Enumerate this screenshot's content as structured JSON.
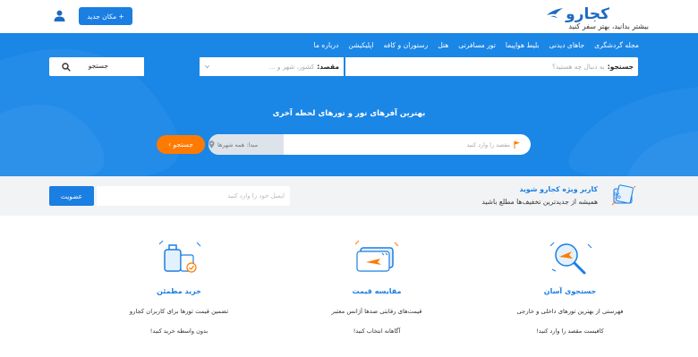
{
  "header": {
    "logo_name": "کجارو",
    "logo_tagline": "بیشتر بدانید، بهتر سفر کنید",
    "add_place_label": "+ مکان جدید",
    "brand_color": "#1d6bc2",
    "icons": {
      "logo": "bird-logo-icon",
      "user": "user-icon"
    }
  },
  "nav": {
    "items": [
      "مجله گردشگری",
      "جاهای دیدنی",
      "بلیط هواپیما",
      "تور مسافرتی",
      "هتل",
      "رستوران و کافه",
      "اپلیکیشن",
      "درباره ما"
    ]
  },
  "search": {
    "what_label": "جستجو:",
    "what_placeholder": "به دنبال چه هستید؟",
    "dest_label": "مقصد:",
    "dest_placeholder": "کشور، شهر و ...",
    "button_label": "جستجو"
  },
  "hero": {
    "title": "بهترین آفرهای تور و تورهای لحظه آخری",
    "origin_placeholder": "مقصد را وارد کنید",
    "origin_value": "مبدا: همه شهرها",
    "search_label": "جستجو ›",
    "background_color": "#1a86e6",
    "accent_color": "#ff7a00"
  },
  "subscribe": {
    "title": "کاربر ویژه کجارو شوید",
    "description": "همیشه از جدیدترین تخفیف‌ها مطلع باشید",
    "email_placeholder": "ایمیل خود را وارد کنید",
    "button_label": "عضویت"
  },
  "features": [
    {
      "icon": "search-plane-icon",
      "title": "جستجوی آسان",
      "line1": "فهرستی از بهترین تورهای داخلی و خارجی",
      "line2": "کافیست مقصد را وارد کنید!"
    },
    {
      "icon": "ticket-compare-icon",
      "title": "مقایسه قیمت",
      "line1": "قیمت‌های رقابتی صدها آژانس معتبر",
      "line2": "آگاهانه انتخاب کنید!"
    },
    {
      "icon": "luggage-shield-icon",
      "title": "خرید مطمئن",
      "line1": "تضمین قیمت تورها برای کاربران کجارو",
      "line2": "بدون واسطه خرید کنید!"
    }
  ]
}
